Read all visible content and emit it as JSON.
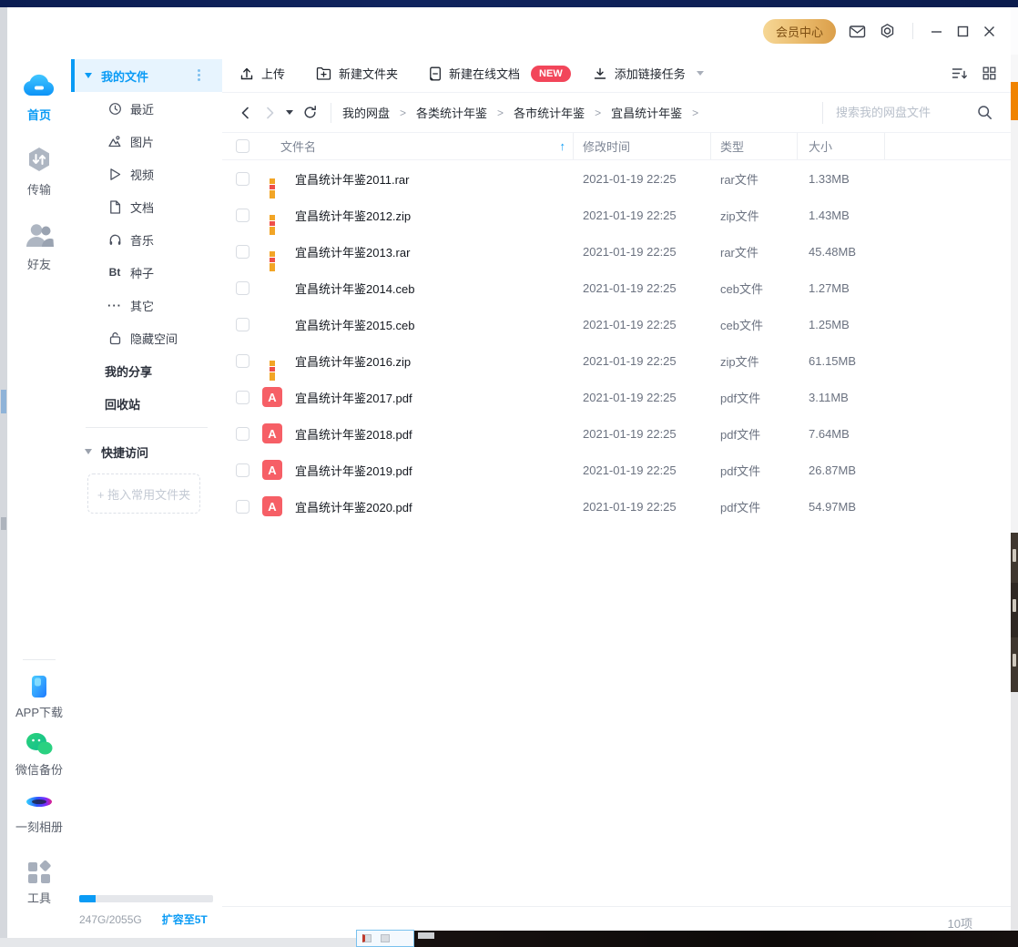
{
  "titlebar": {
    "member_center": "会员中心"
  },
  "rail": {
    "home": "首页",
    "transfer": "传输",
    "friends": "好友",
    "app_download": "APP下载",
    "wechat_backup": "微信备份",
    "photo_album": "一刻相册",
    "tools": "工具"
  },
  "sidebar": {
    "my_files": "我的文件",
    "items": [
      {
        "label": "最近"
      },
      {
        "label": "图片"
      },
      {
        "label": "视频"
      },
      {
        "label": "文档"
      },
      {
        "label": "音乐"
      },
      {
        "label": "种子"
      },
      {
        "label": "其它"
      },
      {
        "label": "隐藏空间"
      }
    ],
    "my_share": "我的分享",
    "recycle_bin": "回收站",
    "quick_access": "快捷访问",
    "drop_hint": "+ 拖入常用文件夹",
    "storage_used": "247G/2055G",
    "expand_link": "扩容至5T",
    "storage_percent": 12
  },
  "toolbar": {
    "upload": "上传",
    "new_folder": "新建文件夹",
    "new_online_doc": "新建在线文档",
    "new_badge": "NEW",
    "add_link_task": "添加链接任务"
  },
  "nav": {
    "breadcrumb": [
      "我的网盘",
      "各类统计年鉴",
      "各市统计年鉴",
      "宜昌统计年鉴"
    ],
    "search_placeholder": "搜索我的网盘文件"
  },
  "table": {
    "columns": {
      "name": "文件名",
      "time": "修改时间",
      "type": "类型",
      "size": "大小"
    },
    "rows": [
      {
        "icon": "rar",
        "name": "宜昌统计年鉴2011.rar",
        "time": "2021-01-19 22:25",
        "type": "rar文件",
        "size": "1.33MB"
      },
      {
        "icon": "rar",
        "name": "宜昌统计年鉴2012.zip",
        "time": "2021-01-19 22:25",
        "type": "zip文件",
        "size": "1.43MB"
      },
      {
        "icon": "rar",
        "name": "宜昌统计年鉴2013.rar",
        "time": "2021-01-19 22:25",
        "type": "rar文件",
        "size": "45.48MB"
      },
      {
        "icon": "ceb",
        "name": "宜昌统计年鉴2014.ceb",
        "time": "2021-01-19 22:25",
        "type": "ceb文件",
        "size": "1.27MB"
      },
      {
        "icon": "ceb",
        "name": "宜昌统计年鉴2015.ceb",
        "time": "2021-01-19 22:25",
        "type": "ceb文件",
        "size": "1.25MB"
      },
      {
        "icon": "rar",
        "name": "宜昌统计年鉴2016.zip",
        "time": "2021-01-19 22:25",
        "type": "zip文件",
        "size": "61.15MB"
      },
      {
        "icon": "pdf",
        "name": "宜昌统计年鉴2017.pdf",
        "time": "2021-01-19 22:25",
        "type": "pdf文件",
        "size": "3.11MB"
      },
      {
        "icon": "pdf",
        "name": "宜昌统计年鉴2018.pdf",
        "time": "2021-01-19 22:25",
        "type": "pdf文件",
        "size": "7.64MB"
      },
      {
        "icon": "pdf",
        "name": "宜昌统计年鉴2019.pdf",
        "time": "2021-01-19 22:25",
        "type": "pdf文件",
        "size": "26.87MB"
      },
      {
        "icon": "pdf",
        "name": "宜昌统计年鉴2020.pdf",
        "time": "2021-01-19 22:25",
        "type": "pdf文件",
        "size": "54.97MB"
      }
    ]
  },
  "statusbar": {
    "item_count": "10项"
  },
  "colors": {
    "accent": "#0a9bf5",
    "gold": "#dda24e",
    "badge_red": "#f2465a"
  }
}
